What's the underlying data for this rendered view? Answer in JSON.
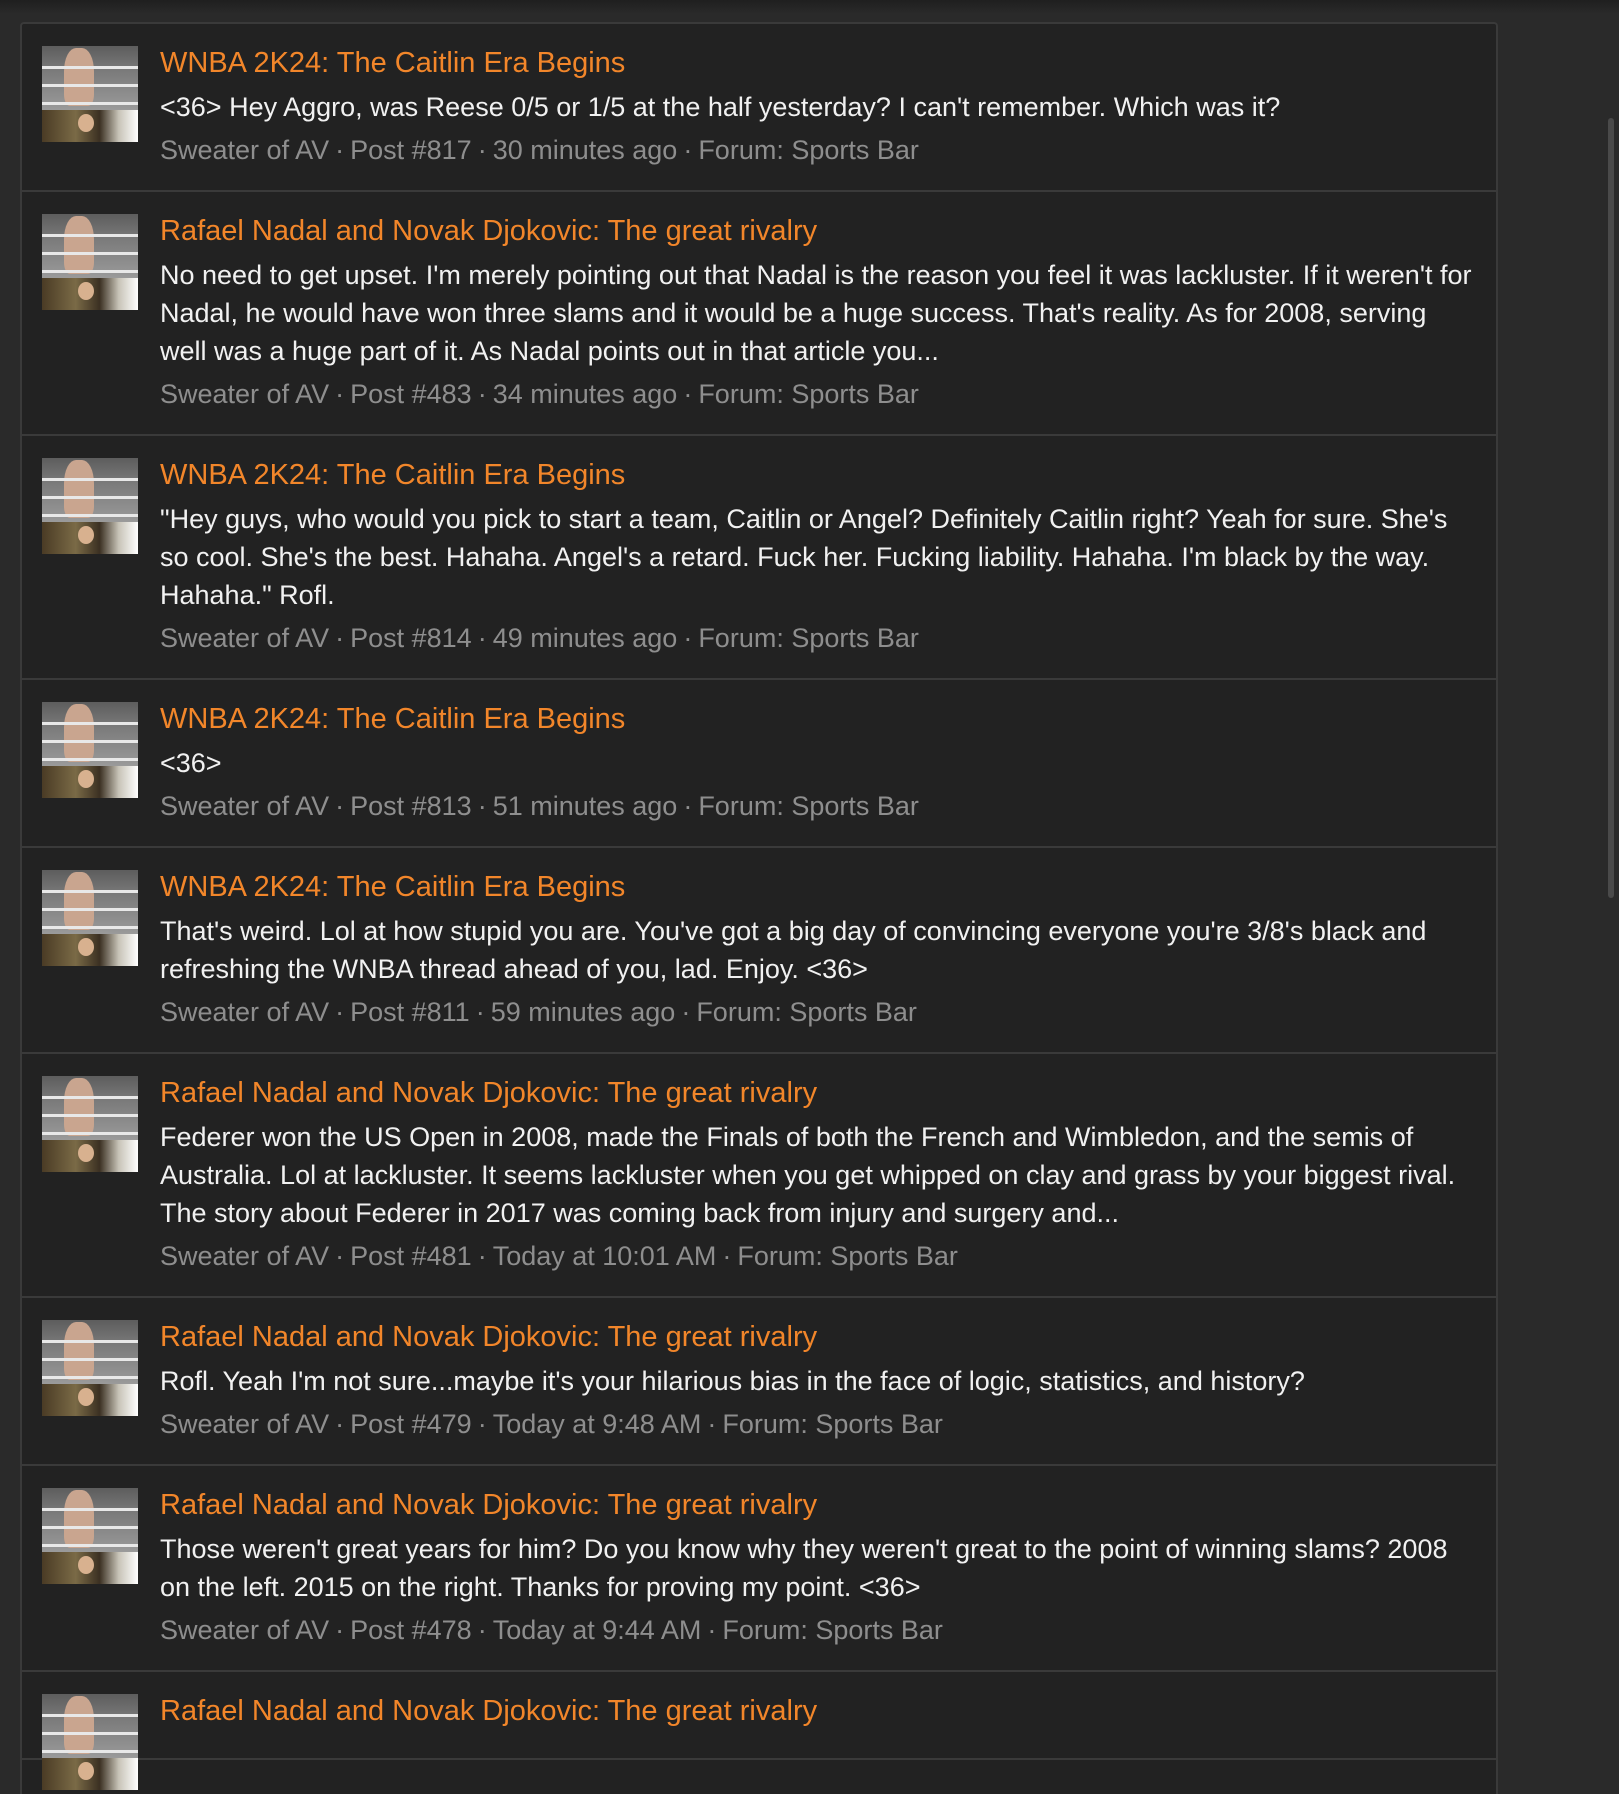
{
  "posts": [
    {
      "thread": "WNBA 2K24: The Caitlin Era Begins",
      "body": "<36> Hey Aggro, was Reese 0/5 or 1/5 at the half yesterday? I can't remember. Which was it?",
      "author": "Sweater of AV",
      "post_no": "Post #817",
      "time": "30 minutes ago",
      "forum": "Forum: Sports Bar"
    },
    {
      "thread": "Rafael Nadal and Novak Djokovic: The great rivalry",
      "body": "No need to get upset. I'm merely pointing out that Nadal is the reason you feel it was lackluster. If it weren't for Nadal, he would have won three slams and it would be a huge success. That's reality. As for 2008, serving well was a huge part of it. As Nadal points out in that article you...",
      "author": "Sweater of AV",
      "post_no": "Post #483",
      "time": "34 minutes ago",
      "forum": "Forum: Sports Bar"
    },
    {
      "thread": "WNBA 2K24: The Caitlin Era Begins",
      "body": "\"Hey guys, who would you pick to start a team, Caitlin or Angel? Definitely Caitlin right? Yeah for sure. She's so cool. She's the best. Hahaha. Angel's a retard. Fuck her. Fucking liability. Hahaha. I'm black by the way. Hahaha.\" Rofl.",
      "author": "Sweater of AV",
      "post_no": "Post #814",
      "time": "49 minutes ago",
      "forum": "Forum: Sports Bar"
    },
    {
      "thread": "WNBA 2K24: The Caitlin Era Begins",
      "body": "<36>",
      "author": "Sweater of AV",
      "post_no": "Post #813",
      "time": "51 minutes ago",
      "forum": "Forum: Sports Bar"
    },
    {
      "thread": "WNBA 2K24: The Caitlin Era Begins",
      "body": "That's weird. Lol at how stupid you are. You've got a big day of convincing everyone you're 3/8's black and refreshing the WNBA thread ahead of you, lad. Enjoy. <36>",
      "author": "Sweater of AV",
      "post_no": "Post #811",
      "time": "59 minutes ago",
      "forum": "Forum: Sports Bar"
    },
    {
      "thread": "Rafael Nadal and Novak Djokovic: The great rivalry",
      "body": "Federer won the US Open in 2008, made the Finals of both the French and Wimbledon, and the semis of Australia. Lol at lackluster. It seems lackluster when you get whipped on clay and grass by your biggest rival. The story about Federer in 2017 was coming back from injury and surgery and...",
      "author": "Sweater of AV",
      "post_no": "Post #481",
      "time": "Today at 10:01 AM",
      "forum": "Forum: Sports Bar"
    },
    {
      "thread": "Rafael Nadal and Novak Djokovic: The great rivalry",
      "body": "Rofl. Yeah I'm not sure...maybe it's your hilarious bias in the face of logic, statistics, and history?",
      "author": "Sweater of AV",
      "post_no": "Post #479",
      "time": "Today at 9:48 AM",
      "forum": "Forum: Sports Bar"
    },
    {
      "thread": "Rafael Nadal and Novak Djokovic: The great rivalry",
      "body": "Those weren't great years for him? Do you know why they weren't great to the point of winning slams? 2008 on the left. 2015 on the right. Thanks for proving my point. <36>",
      "author": "Sweater of AV",
      "post_no": "Post #478",
      "time": "Today at 9:44 AM",
      "forum": "Forum: Sports Bar"
    },
    {
      "thread": "Rafael Nadal and Novak Djokovic: The great rivalry",
      "body": "",
      "author": "",
      "post_no": "",
      "time": "",
      "forum": ""
    }
  ],
  "meta_separator": "·",
  "colors": {
    "thread_link": "#f2862a",
    "body_text": "#f1f1f1",
    "meta_text": "#8e8e8e",
    "background": "#222222"
  }
}
